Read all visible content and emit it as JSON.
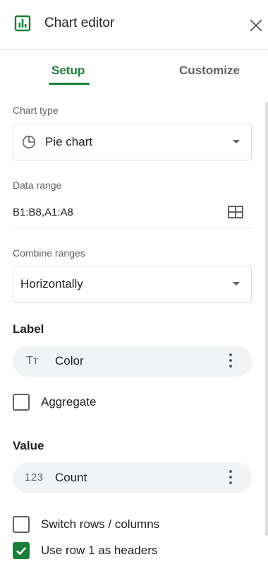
{
  "header": {
    "title": "Chart editor",
    "icon": "chart-icon",
    "close_icon": "close-icon"
  },
  "tabs": [
    {
      "label": "Setup",
      "active": true
    },
    {
      "label": "Customize",
      "active": false
    }
  ],
  "chart_type": {
    "label": "Chart type",
    "value": "Pie chart",
    "icon": "pie-chart-icon"
  },
  "data_range": {
    "label": "Data range",
    "value": "B1:B8,A1:A8",
    "icon": "grid-icon"
  },
  "combine_ranges": {
    "label": "Combine ranges",
    "value": "Horizontally"
  },
  "label_section": {
    "heading": "Label",
    "chip_label": "Color",
    "chip_icon": "Tт",
    "aggregate": {
      "label": "Aggregate",
      "checked": false
    }
  },
  "value_section": {
    "heading": "Value",
    "chip_label": "Count",
    "chip_icon": "123"
  },
  "options": [
    {
      "label": "Switch rows / columns",
      "checked": false
    },
    {
      "label": "Use row 1 as headers",
      "checked": true
    }
  ],
  "colors": {
    "accent": "#188038",
    "text": "#202124",
    "muted": "#5f6368",
    "border": "#dadce0",
    "chip_bg": "#f1f3f4"
  }
}
